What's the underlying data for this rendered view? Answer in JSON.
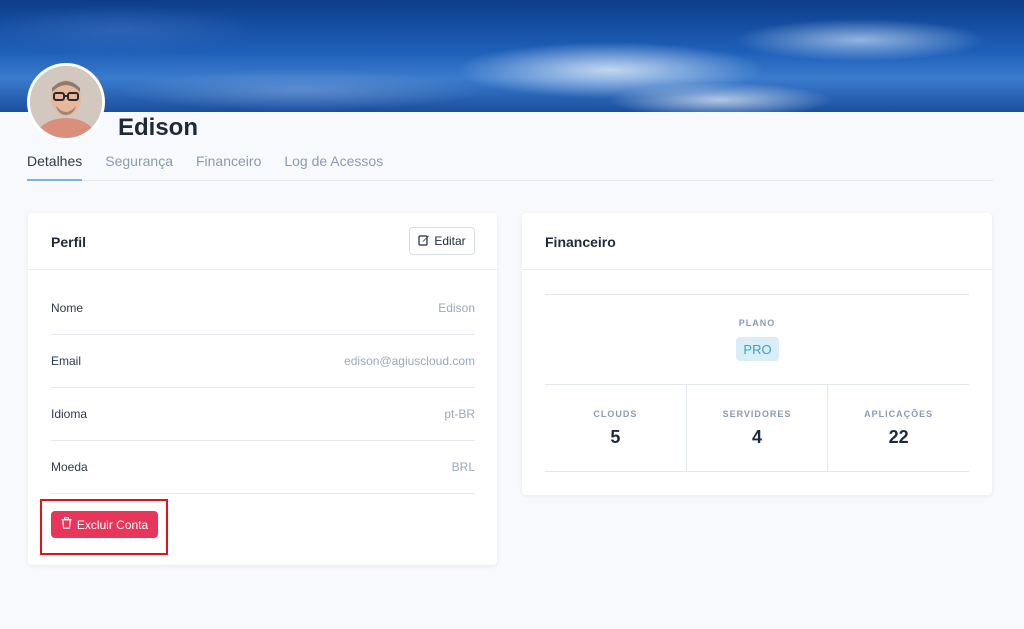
{
  "profile": {
    "name": "Edison"
  },
  "tabs": [
    "Detalhes",
    "Segurança",
    "Financeiro",
    "Log de Acessos"
  ],
  "perfil_card": {
    "title": "Perfil",
    "edit_label": "Editar",
    "rows": [
      {
        "label": "Nome",
        "value": "Edison"
      },
      {
        "label": "Email",
        "value": "edison@agiuscloud.com"
      },
      {
        "label": "Idioma",
        "value": "pt-BR"
      },
      {
        "label": "Moeda",
        "value": "BRL"
      }
    ],
    "delete_label": "Excluir Conta"
  },
  "financeiro_card": {
    "title": "Financeiro",
    "plan_label": "PLANO",
    "plan_value": "PRO",
    "stats": [
      {
        "label": "CLOUDS",
        "value": "5"
      },
      {
        "label": "SERVIDORES",
        "value": "4"
      },
      {
        "label": "APLICAÇÕES",
        "value": "22"
      }
    ]
  },
  "colors": {
    "accent": "#7fb4e0",
    "danger": "#e8365a",
    "badge_bg": "#d9eef8",
    "badge_text": "#3ba1cf",
    "highlight": "#e0121b"
  },
  "icons": [
    "edit-icon",
    "trash-icon"
  ]
}
